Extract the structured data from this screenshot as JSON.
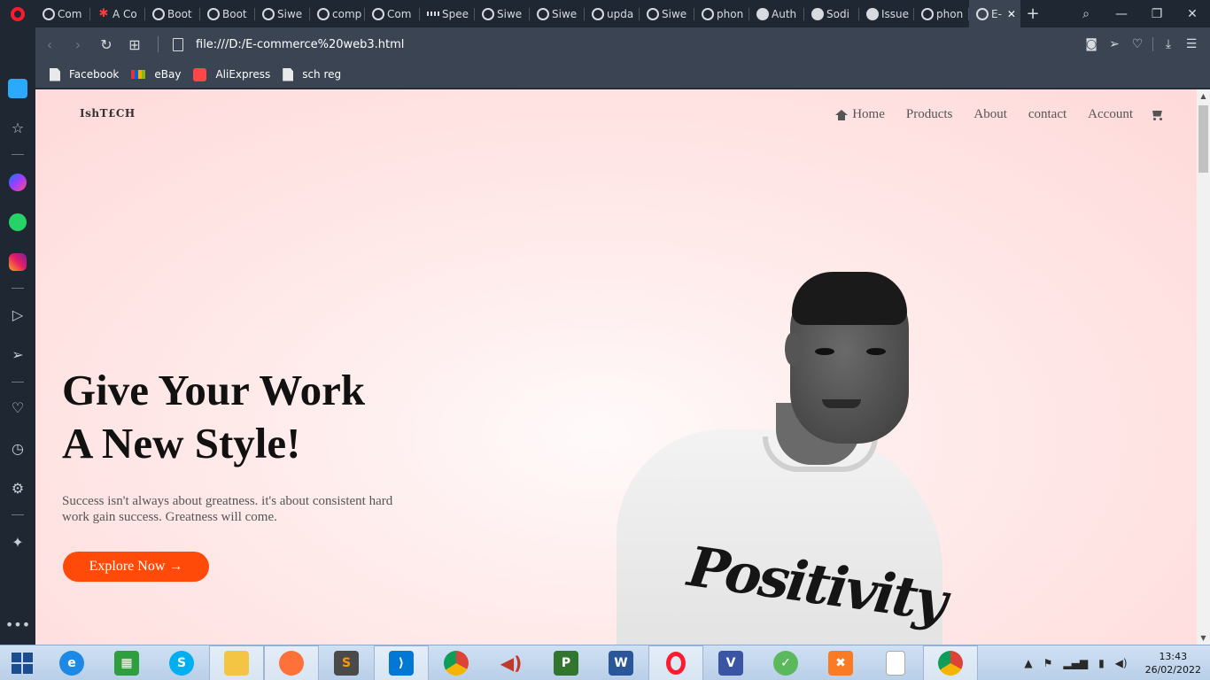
{
  "browser": {
    "tabs": [
      {
        "label": "Com",
        "icon": "globe-icon"
      },
      {
        "label": "A Co",
        "icon": "asterisk-icon"
      },
      {
        "label": "Boot",
        "icon": "globe-icon"
      },
      {
        "label": "Boot",
        "icon": "globe-icon"
      },
      {
        "label": "Siwe",
        "icon": "globe-icon"
      },
      {
        "label": "comp",
        "icon": "globe-icon"
      },
      {
        "label": "Com",
        "icon": "globe-icon"
      },
      {
        "label": "Spee",
        "icon": "grid-icon"
      },
      {
        "label": "Siwe",
        "icon": "globe-icon"
      },
      {
        "label": "Siwe",
        "icon": "globe-icon"
      },
      {
        "label": "upda",
        "icon": "globe-icon"
      },
      {
        "label": "Siwe",
        "icon": "globe-icon"
      },
      {
        "label": "phon",
        "icon": "globe-icon"
      },
      {
        "label": "Auth",
        "icon": "github-icon"
      },
      {
        "label": "Sodi",
        "icon": "github-icon"
      },
      {
        "label": "Issue",
        "icon": "github-icon"
      },
      {
        "label": "phon",
        "icon": "globe-icon"
      }
    ],
    "active_tab": {
      "label": "E-",
      "icon": "globe-icon"
    },
    "url": "file:///D:/E-commerce%20web3.html",
    "bookmarks": [
      {
        "label": "Facebook",
        "icon": "document-icon"
      },
      {
        "label": "eBay",
        "icon": "ebay-icon"
      },
      {
        "label": "AliExpress",
        "icon": "aliexpress-icon"
      },
      {
        "label": "sch reg",
        "icon": "document-icon"
      }
    ]
  },
  "page": {
    "logo": "IshT£CH",
    "nav": {
      "home": "Home",
      "products": "Products",
      "about": "About",
      "contact": "contact",
      "account": "Account"
    },
    "hero": {
      "title_line1": "Give Your Work",
      "title_line2": "A New Style!",
      "text": "Success isn't always about greatness. it's about consistent hard work gain success. Greatness will come.",
      "button": "Explore Now →"
    },
    "portrait_shirt_text": "Positivity",
    "colors": {
      "accent": "#ff4a0a",
      "background": "#ffd9d9"
    }
  },
  "taskbar": {
    "time": "13:43",
    "date": "26/02/2022"
  }
}
